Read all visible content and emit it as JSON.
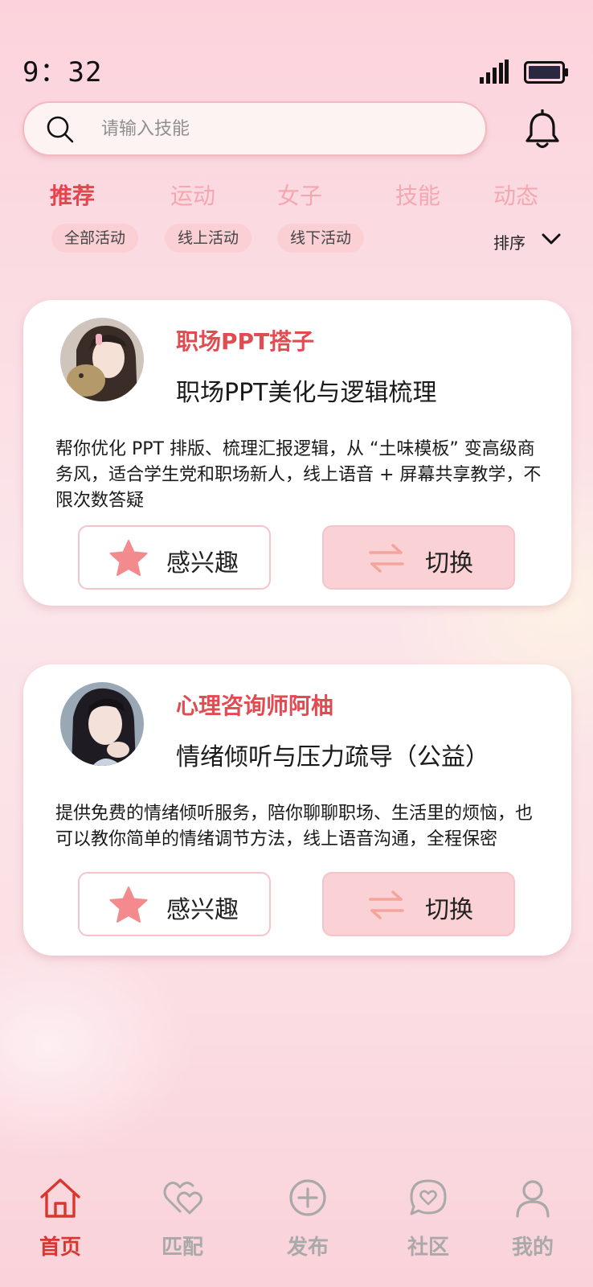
{
  "status_bar": {
    "time": "9：32"
  },
  "search": {
    "placeholder": "请输入技能"
  },
  "tabs": [
    {
      "label": "推荐",
      "active": true
    },
    {
      "label": "运动"
    },
    {
      "label": "女子"
    },
    {
      "label": "技能"
    },
    {
      "label": "动态"
    }
  ],
  "filters": [
    {
      "label": "全部活动"
    },
    {
      "label": "线上活动"
    },
    {
      "label": "线下活动"
    }
  ],
  "sort": {
    "label": "排序"
  },
  "cards": [
    {
      "name": "职场PPT搭子",
      "title": "职场PPT美化与逻辑梳理",
      "description": "帮你优化 PPT 排版、梳理汇报逻辑，从 “土味模板” 变高级商务风，适合学生党和职场新人，线上语音 + 屏幕共享教学，不限次数答疑",
      "interest_label": "感兴趣",
      "switch_label": "切换"
    },
    {
      "name": "心理咨询师阿柚",
      "title": "情绪倾听与压力疏导（公益）",
      "description": "提供免费的情绪倾听服务，陪你聊聊职场、生活里的烦恼，也可以教你简单的情绪调节方法，线上语音沟通，全程保密",
      "interest_label": "感兴趣",
      "switch_label": "切换"
    }
  ],
  "bottom_nav": [
    {
      "label": "首页",
      "icon": "home-icon",
      "active": true
    },
    {
      "label": "匹配",
      "icon": "heart-match-icon"
    },
    {
      "label": "发布",
      "icon": "plus-circle-icon"
    },
    {
      "label": "社区",
      "icon": "chat-heart-icon"
    },
    {
      "label": "我的",
      "icon": "user-icon"
    }
  ],
  "colors": {
    "accent": "#e4454f",
    "tab_inactive": "#f3a8af",
    "chip_bg": "#fad0d4",
    "nav_active": "#d8362e",
    "nav_inactive": "#a9a9a9",
    "star": "#f28a8e"
  }
}
